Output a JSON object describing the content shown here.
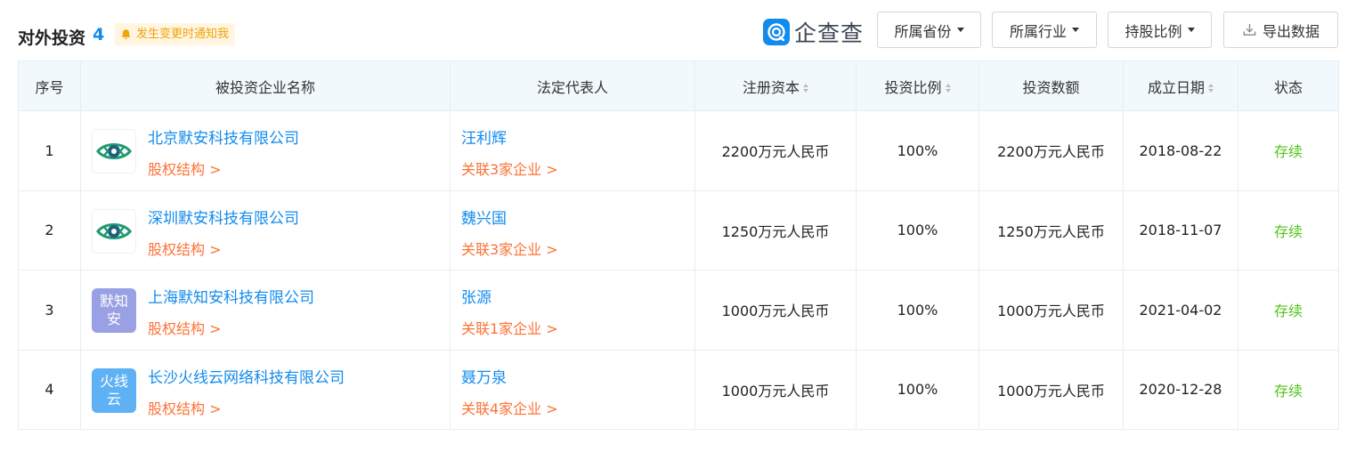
{
  "header": {
    "title": "对外投资",
    "count": "4",
    "notify_label": "发生变更时通知我",
    "logo_text": "企查查",
    "filters": {
      "province": "所属省份",
      "industry": "所属行业",
      "ratio": "持股比例"
    },
    "export_label": "导出数据"
  },
  "columns": {
    "index": "序号",
    "company": "被投资企业名称",
    "legal": "法定代表人",
    "capital": "注册资本",
    "ratio": "投资比例",
    "amount": "投资数额",
    "date": "成立日期",
    "status": "状态"
  },
  "rows": [
    {
      "index": "1",
      "avatar_type": "eye-logo",
      "company": "北京默安科技有限公司",
      "equity_link": "股权结构 >",
      "legal": "汪利辉",
      "related": "关联3家企业 >",
      "capital": "2200万元人民币",
      "ratio": "100%",
      "amount": "2200万元人民币",
      "date": "2018-08-22",
      "status": "存续"
    },
    {
      "index": "2",
      "avatar_type": "eye-logo",
      "company": "深圳默安科技有限公司",
      "equity_link": "股权结构 >",
      "legal": "魏兴国",
      "related": "关联3家企业 >",
      "capital": "1250万元人民币",
      "ratio": "100%",
      "amount": "1250万元人民币",
      "date": "2018-11-07",
      "status": "存续"
    },
    {
      "index": "3",
      "avatar_type": "text",
      "avatar_text": "默知安",
      "avatar_color": "#9aa0e4",
      "company": "上海默知安科技有限公司",
      "equity_link": "股权结构 >",
      "legal": "张源",
      "related": "关联1家企业 >",
      "capital": "1000万元人民币",
      "ratio": "100%",
      "amount": "1000万元人民币",
      "date": "2021-04-02",
      "status": "存续"
    },
    {
      "index": "4",
      "avatar_type": "text",
      "avatar_text": "火线云",
      "avatar_color": "#5fb1f6",
      "company": "长沙火线云网络科技有限公司",
      "equity_link": "股权结构 >",
      "legal": "聂万泉",
      "related": "关联4家企业 >",
      "capital": "1000万元人民币",
      "ratio": "100%",
      "amount": "1000万元人民币",
      "date": "2020-12-28",
      "status": "存续"
    }
  ],
  "colors": {
    "link": "#128bed",
    "accent_orange": "#fd7236",
    "status_green": "#52c41a",
    "header_bg": "#f2f9fc"
  }
}
